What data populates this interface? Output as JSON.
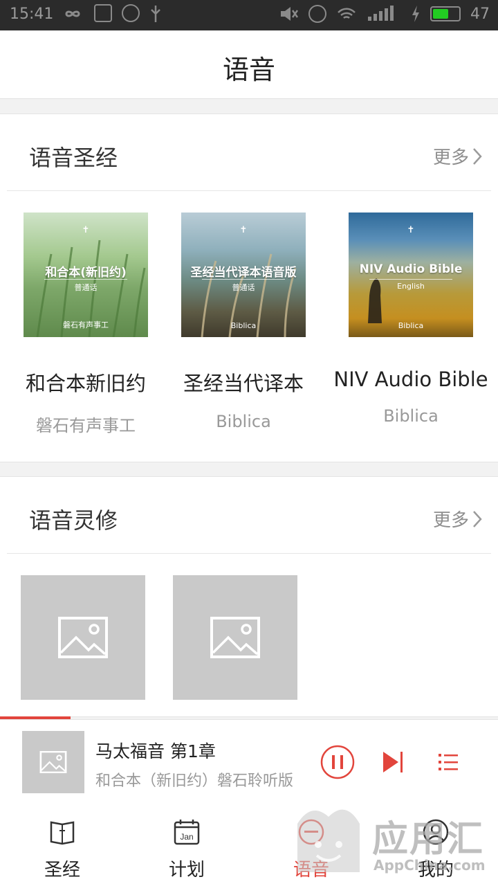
{
  "status_bar": {
    "time": "15:41",
    "battery": "47",
    "accent_color": "#22cc22"
  },
  "header": {
    "title": "语音"
  },
  "section_audio_bible": {
    "title": "语音圣经",
    "more_label": "更多",
    "albums": [
      {
        "name": "和合本新旧约",
        "publisher": "磐石有声事工",
        "cover_title": "和合本(新旧约)",
        "cover_sub": "普通话",
        "cover_pub": "磐石有声事工",
        "cover_cross": "✝"
      },
      {
        "name": "圣经当代译本",
        "publisher": "Biblica",
        "cover_title": "圣经当代译本语音版",
        "cover_sub": "普通话",
        "cover_pub": "Biblica",
        "cover_cross": "✝"
      },
      {
        "name": "NIV Audio Bible",
        "publisher": "Biblica",
        "cover_title": "NIV Audio Bible",
        "cover_sub": "English",
        "cover_pub": "Biblica",
        "cover_cross": "✝"
      }
    ]
  },
  "section_devotion": {
    "title": "语音灵修",
    "more_label": "更多",
    "items": [
      {
        "icon": "image-placeholder-icon"
      },
      {
        "icon": "image-placeholder-icon"
      }
    ]
  },
  "player": {
    "title": "马太福音 第1章",
    "subtitle": "和合本（新旧约）磐石聆听版",
    "accent_color": "#e2453c"
  },
  "tabbar": {
    "tabs": [
      {
        "label": "圣经",
        "icon": "bible-book-icon"
      },
      {
        "label": "计划",
        "icon": "calendar-icon",
        "icon_text": "Jan"
      },
      {
        "label": "语音",
        "icon": "audio-icon",
        "active": true
      },
      {
        "label": "我的",
        "icon": "profile-icon"
      }
    ]
  },
  "watermark": {
    "text": "应用汇",
    "sub": "AppChina.com"
  }
}
